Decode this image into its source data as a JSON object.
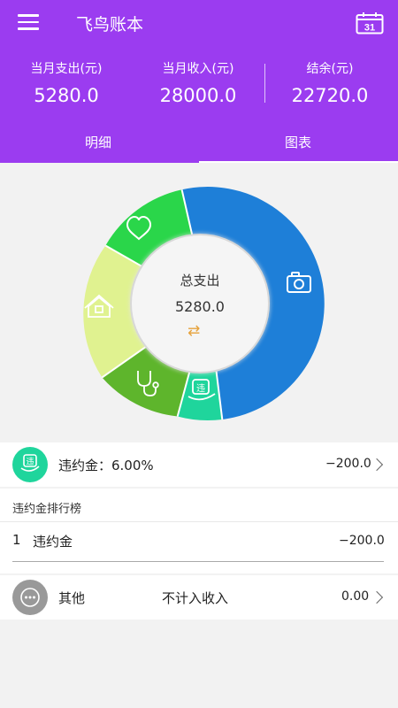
{
  "app": {
    "title": "飞鸟账本",
    "calendar_day": "31"
  },
  "stats": [
    {
      "label": "当月支出(元)",
      "value": "5280.0"
    },
    {
      "label": "当月收入(元)",
      "value": "28000.0"
    },
    {
      "label": "结余(元)",
      "value": "22720.0"
    }
  ],
  "tabs": {
    "detail": "明细",
    "chart": "图表",
    "active": "图表"
  },
  "chart_data": {
    "type": "pie",
    "center_title": "总支出",
    "center_value": "5280.0",
    "slices": [
      {
        "color": "#1e7fd8",
        "icon": "camera-icon"
      },
      {
        "color": "#1fd59c",
        "icon": "violation-icon"
      },
      {
        "color": "#5eb52c",
        "icon": "stethoscope-icon"
      },
      {
        "color": "#e0f290",
        "icon": "house-icon"
      },
      {
        "color": "#2ad64a",
        "icon": "heart-icon"
      }
    ]
  },
  "category_item": {
    "icon": "violation-icon",
    "name": "违约金：6.00%",
    "amount": "−200.0"
  },
  "ranking": {
    "title": "违约金排行榜",
    "items": [
      {
        "rank": "1",
        "name": "违约金",
        "amount": "−200.0"
      }
    ]
  },
  "other_item": {
    "icon": "more-icon",
    "name": "其他",
    "note": "不计入收入",
    "amount": "0.00"
  },
  "colors": {
    "header": "#9b3cf0",
    "accent_swap": "#e6a23c"
  }
}
